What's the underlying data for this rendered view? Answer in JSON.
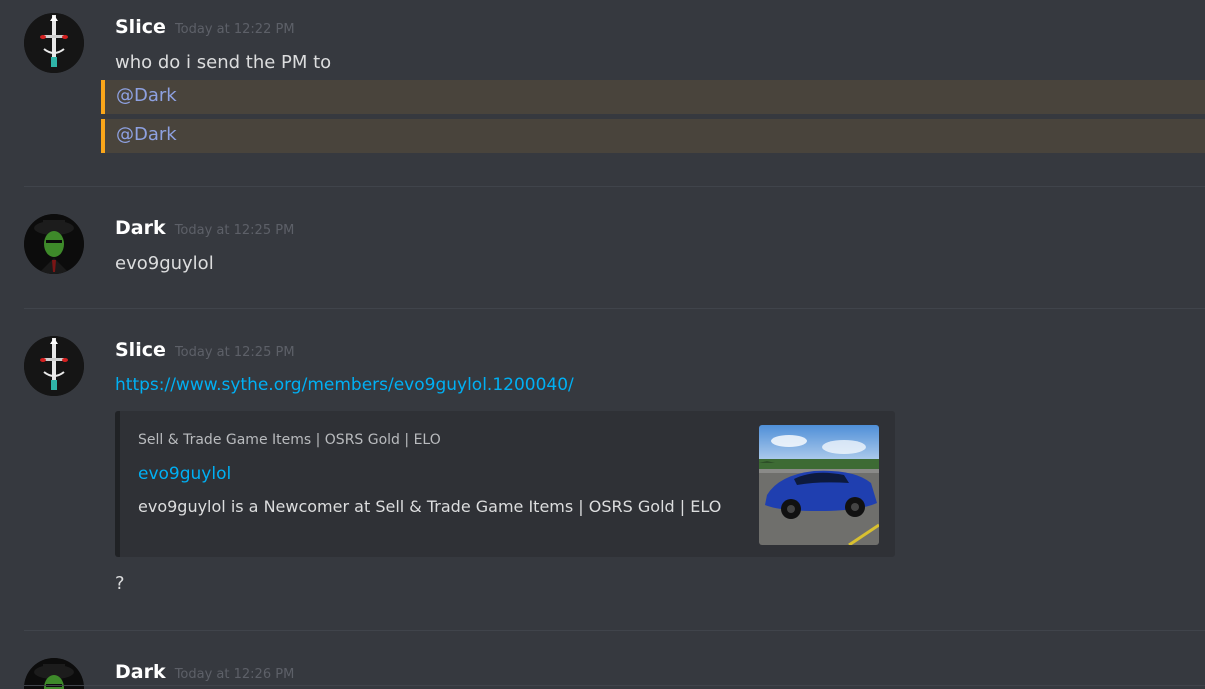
{
  "messages": [
    {
      "username": "Slice",
      "timestamp": "Today at 12:22 PM",
      "text": "who do i send the PM to",
      "mentions": [
        "@Dark",
        "@Dark"
      ]
    },
    {
      "username": "Dark",
      "timestamp": "Today at 12:25 PM",
      "text": "evo9guylol"
    },
    {
      "username": "Slice",
      "timestamp": "Today at 12:25 PM",
      "link": "https://www.sythe.org/members/evo9guylol.1200040/",
      "embed": {
        "provider": "Sell & Trade Game Items | OSRS Gold | ELO",
        "title": "evo9guylol",
        "description": "evo9guylol is a Newcomer at Sell & Trade Game Items | OSRS Gold | ELO"
      },
      "followup": "?"
    },
    {
      "username": "Dark",
      "timestamp": "Today at 12:26 PM"
    }
  ],
  "colors": {
    "background": "#36393f",
    "mention_highlight": "#49443c",
    "mention_bar": "#faa61a",
    "mention_text": "#8ea1e1",
    "link": "#00b0f4"
  }
}
